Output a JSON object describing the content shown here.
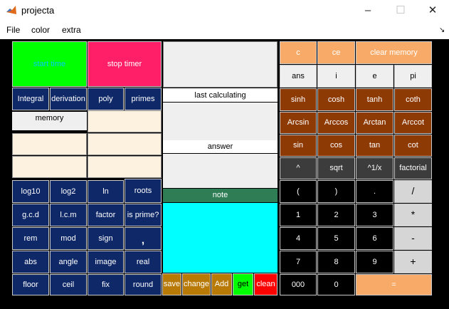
{
  "window": {
    "title": "projecta",
    "controls": {
      "minimize": "–",
      "maximize": "☐",
      "close": "✕"
    }
  },
  "menu": {
    "items": [
      "File",
      "color",
      "extra"
    ],
    "corner": "↘"
  },
  "left": {
    "start_timer": "start time",
    "stop_timer": "stop timer",
    "integral": "Integral",
    "derivation": "derivation",
    "poly": "poly",
    "primes": "primes",
    "memory": "memory",
    "func_buttons": [
      [
        "log10",
        "log2",
        "ln",
        "roots"
      ],
      [
        "g.c.d",
        "l.c.m",
        "factor",
        "is prime?"
      ],
      [
        "rem",
        "mod",
        "sign",
        ","
      ],
      [
        "abs",
        "angle",
        "image",
        "real"
      ],
      [
        "floor",
        "ceil",
        "fix",
        "round"
      ]
    ]
  },
  "middle": {
    "last_calculating": "last calculating",
    "answer": "answer",
    "note": "note",
    "actions": [
      "save",
      "change",
      "Add",
      "get",
      "clean"
    ]
  },
  "right": {
    "c": "c",
    "ce": "ce",
    "clear_memory": "clear memory",
    "row2": [
      "ans",
      "i",
      "e",
      "pi"
    ],
    "hyper": [
      "sinh",
      "cosh",
      "tanh",
      "coth"
    ],
    "arc": [
      "Arcsin",
      "Arccos",
      "Arctan",
      "Arccot"
    ],
    "trig": [
      "sin",
      "cos",
      "tan",
      "cot"
    ],
    "power": [
      "^",
      "sqrt",
      "^1/x",
      "factorial"
    ],
    "keys": [
      [
        "(",
        ")",
        ".",
        "/"
      ],
      [
        "1",
        "2",
        "3",
        "*"
      ],
      [
        "4",
        "5",
        "6",
        "-"
      ],
      [
        "7",
        "8",
        "9",
        "+"
      ]
    ],
    "zeros": [
      "000",
      "0"
    ],
    "equals": "="
  },
  "colors": {
    "start_green": "#00ff00",
    "start_text": "#00c8ff",
    "stop_pink": "#ff1f68",
    "note_green": "#2e7d55",
    "cyan": "#00ffff",
    "navy": "#0f2868",
    "brown": "#8e3a05",
    "peach": "#f8ab68",
    "action_gold": "#b87a05",
    "get_green": "#00ff00",
    "clean_red": "#ff0000"
  }
}
